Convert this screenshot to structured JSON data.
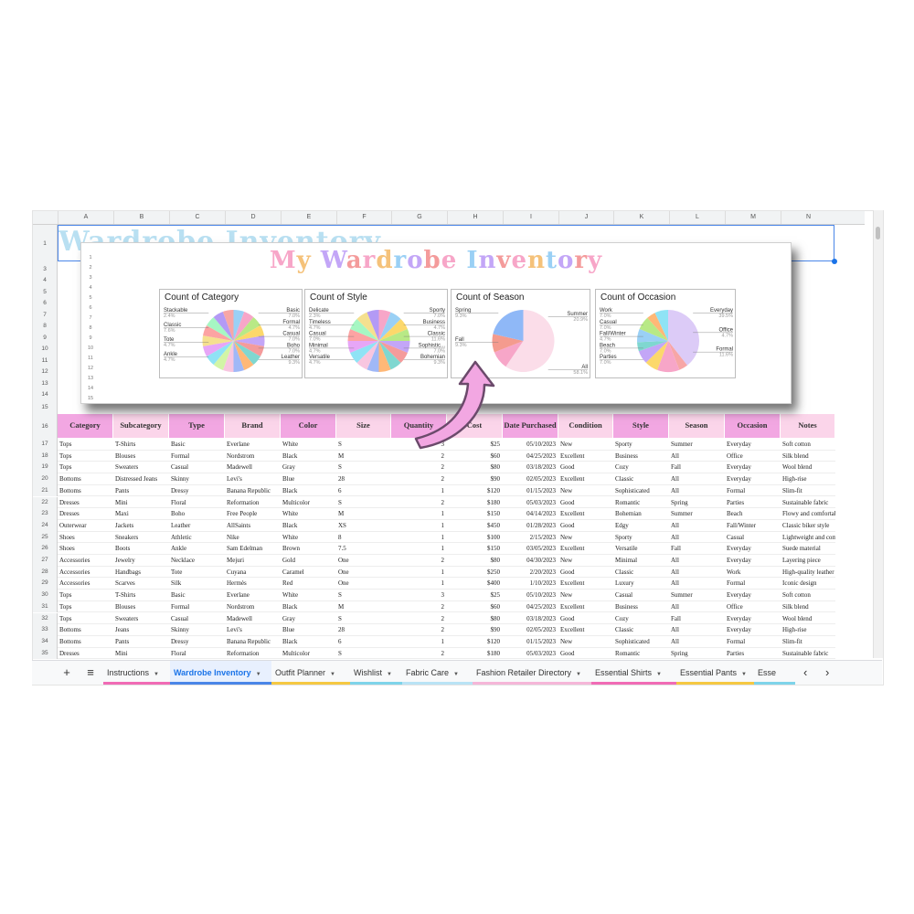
{
  "columns": [
    "A",
    "B",
    "C",
    "D",
    "E",
    "F",
    "G",
    "H",
    "I",
    "J",
    "K",
    "L",
    "M",
    "N"
  ],
  "row_numbers": [
    "1",
    "3",
    "4",
    "5",
    "6",
    "7",
    "8",
    "9",
    "10",
    "11",
    "12",
    "13",
    "14",
    "15",
    "16",
    "17",
    "18",
    "19",
    "20",
    "21",
    "22",
    "23",
    "24",
    "25",
    "26",
    "27",
    "28",
    "29",
    "30",
    "31",
    "32",
    "33",
    "34",
    "35"
  ],
  "sheet_title": "Wardrobe Inventory",
  "overlay": {
    "title": "My Wardrobe Inventory",
    "row_numbers": [
      "1",
      "2",
      "3",
      "4",
      "5",
      "6",
      "7",
      "8",
      "9",
      "10",
      "11",
      "12",
      "13",
      "14",
      "15"
    ]
  },
  "charts": [
    {
      "title": "Count of Category",
      "labels": [
        {
          "t": "Stackable",
          "p": "2.4%"
        },
        {
          "t": "Classic",
          "p": "7.6%"
        },
        {
          "t": "Tote",
          "p": "4.7%"
        },
        {
          "t": "Ankle",
          "p": "4.7%"
        },
        {
          "t": "Basic",
          "p": "7.0%"
        },
        {
          "t": "Formal",
          "p": "4.7%"
        },
        {
          "t": "Casual",
          "p": "7.0%"
        },
        {
          "t": "Boho",
          "p": "7.0%"
        },
        {
          "t": "Leather",
          "p": "9.3%"
        }
      ],
      "colors": [
        "#9ad0f5",
        "#f7a6c8",
        "#b8e986",
        "#fcd86b",
        "#c3a6f7",
        "#f49b9b",
        "#7fd7d0",
        "#ffb877",
        "#a0b8f7",
        "#f7c6e0",
        "#d2f5a6",
        "#8fe3f5",
        "#e7a6f7",
        "#f5e08f",
        "#fca3a3",
        "#a6f7c3",
        "#b39af5",
        "#f7a6a6"
      ]
    },
    {
      "title": "Count of Style",
      "labels": [
        {
          "t": "Delicate",
          "p": "2.3%"
        },
        {
          "t": "Timeless",
          "p": "4.7%"
        },
        {
          "t": "Casual",
          "p": "7.0%"
        },
        {
          "t": "Minimal",
          "p": "4.7%"
        },
        {
          "t": "Versatile",
          "p": "4.7%"
        },
        {
          "t": "Sporty",
          "p": "7.0%"
        },
        {
          "t": "Business",
          "p": "4.7%"
        },
        {
          "t": "Classic",
          "p": "11.6%"
        },
        {
          "t": "Sophistic...",
          "p": "7.0%"
        },
        {
          "t": "Bohemian",
          "p": "9.3%"
        }
      ],
      "colors": [
        "#f7a6c8",
        "#9ad0f5",
        "#fcd86b",
        "#b8e986",
        "#c3a6f7",
        "#f49b9b",
        "#7fd7d0",
        "#ffb877",
        "#a0b8f7",
        "#f7c6e0",
        "#8fe3f5",
        "#e7a6f7",
        "#fca3a3",
        "#a6f7c3",
        "#f5e08f",
        "#b39af5"
      ]
    },
    {
      "title": "Count of Season",
      "labels": [
        {
          "t": "Spring",
          "p": "9.3%"
        },
        {
          "t": "Fall",
          "p": "9.3%"
        },
        {
          "t": "Summer",
          "p": "20.9%"
        },
        {
          "t": "All",
          "p": "58.1%"
        }
      ],
      "values": [
        58.1,
        9.3,
        9.3,
        20.9
      ],
      "colors": [
        "#fbdde9",
        "#f7a6c8",
        "#f49b8e",
        "#8fb8f7"
      ]
    },
    {
      "title": "Count of Occasion",
      "labels": [
        {
          "t": "Work",
          "p": "7.0%"
        },
        {
          "t": "Casual",
          "p": "7.0%"
        },
        {
          "t": "Fall/Winter",
          "p": "4.7%"
        },
        {
          "t": "Beach",
          "p": "7.0%"
        },
        {
          "t": "Parties",
          "p": "7.0%"
        },
        {
          "t": "Everyday",
          "p": "39.5%"
        },
        {
          "t": "Office",
          "p": "4.7%"
        },
        {
          "t": "Formal",
          "p": "11.6%"
        }
      ],
      "values": [
        39.5,
        4.7,
        11.6,
        7.0,
        7.0,
        4.7,
        7.0,
        7.0,
        4.7,
        7.0
      ],
      "colors": [
        "#dccbf7",
        "#f7a6a6",
        "#f7a6c8",
        "#fcd86b",
        "#c3a6f7",
        "#7fd7d0",
        "#9ad0f5",
        "#b8e986",
        "#ffb877",
        "#8fe3f5"
      ]
    }
  ],
  "header": [
    "Category",
    "Subcategory",
    "Type",
    "Brand",
    "Color",
    "Size",
    "Quantity",
    "Cost",
    "Date Purchased",
    "Condition",
    "Style",
    "Season",
    "Occasion",
    "Notes"
  ],
  "header_colors": [
    "#f2a7e2",
    "#fbd5ea",
    "#f2a7e2",
    "#fbd5ea",
    "#f2a7e2",
    "#fbd5ea",
    "#f2a7e2",
    "#fbd5ea",
    "#f2a7e2",
    "#fbd5ea",
    "#f2a7e2",
    "#fbd5ea",
    "#f2a7e2",
    "#fbd5ea"
  ],
  "rows": [
    [
      "Tops",
      "T-Shirts",
      "Basic",
      "Everlane",
      "White",
      "S",
      "3",
      "$25",
      "05/10/2023",
      "New",
      "Sporty",
      "Summer",
      "Everyday",
      "Soft cotton"
    ],
    [
      "Tops",
      "Blouses",
      "Formal",
      "Nordstrom",
      "Black",
      "M",
      "2",
      "$60",
      "04/25/2023",
      "Excellent",
      "Business",
      "All",
      "Office",
      "Silk blend"
    ],
    [
      "Tops",
      "Sweaters",
      "Casual",
      "Madewell",
      "Gray",
      "S",
      "2",
      "$80",
      "03/18/2023",
      "Good",
      "Cozy",
      "Fall",
      "Everyday",
      "Wool blend"
    ],
    [
      "Bottoms",
      "Distressed Jeans",
      "Skinny",
      "Levi's",
      "Blue",
      "28",
      "2",
      "$90",
      "02/05/2023",
      "Excellent",
      "Classic",
      "All",
      "Everyday",
      "High-rise"
    ],
    [
      "Bottoms",
      "Pants",
      "Dressy",
      "Banana Republic",
      "Black",
      "6",
      "1",
      "$120",
      "01/15/2023",
      "New",
      "Sophisticated",
      "All",
      "Formal",
      "Slim-fit"
    ],
    [
      "Dresses",
      "Mini",
      "Floral",
      "Reformation",
      "Multicolor",
      "S",
      "2",
      "$180",
      "05/03/2023",
      "Good",
      "Romantic",
      "Spring",
      "Parties",
      "Sustainable fabric"
    ],
    [
      "Dresses",
      "Maxi",
      "Boho",
      "Free People",
      "White",
      "M",
      "1",
      "$150",
      "04/14/2023",
      "Excellent",
      "Bohemian",
      "Summer",
      "Beach",
      "Flowy and comfortable"
    ],
    [
      "Outerwear",
      "Jackets",
      "Leather",
      "AllSaints",
      "Black",
      "XS",
      "1",
      "$450",
      "01/28/2023",
      "Good",
      "Edgy",
      "All",
      "Fall/Winter",
      "Classic biker style"
    ],
    [
      "Shoes",
      "Sneakers",
      "Athletic",
      "Nike",
      "White",
      "8",
      "1",
      "$100",
      "2/15/2023",
      "New",
      "Sporty",
      "All",
      "Casual",
      "Lightweight and comfortable"
    ],
    [
      "Shoes",
      "Boots",
      "Ankle",
      "Sam Edelman",
      "Brown",
      "7.5",
      "1",
      "$150",
      "03/05/2023",
      "Excellent",
      "Versatile",
      "Fall",
      "Everyday",
      "Suede material"
    ],
    [
      "Accessories",
      "Jewelry",
      "Necklace",
      "Mejuri",
      "Gold",
      "One",
      "2",
      "$80",
      "04/30/2023",
      "New",
      "Minimal",
      "All",
      "Everyday",
      "Layering piece"
    ],
    [
      "Accessories",
      "Handbags",
      "Tote",
      "Cuyana",
      "Caramel",
      "One",
      "1",
      "$250",
      "2/20/2023",
      "Good",
      "Classic",
      "All",
      "Work",
      "High-quality leather"
    ],
    [
      "Accessories",
      "Scarves",
      "Silk",
      "Hermès",
      "Red",
      "One",
      "1",
      "$400",
      "1/10/2023",
      "Excellent",
      "Luxury",
      "All",
      "Formal",
      "Iconic design"
    ],
    [
      "Tops",
      "T-Shirts",
      "Basic",
      "Everlane",
      "White",
      "S",
      "3",
      "$25",
      "05/10/2023",
      "New",
      "Casual",
      "Summer",
      "Everyday",
      "Soft cotton"
    ],
    [
      "Tops",
      "Blouses",
      "Formal",
      "Nordstrom",
      "Black",
      "M",
      "2",
      "$60",
      "04/25/2023",
      "Excellent",
      "Business",
      "All",
      "Office",
      "Silk blend"
    ],
    [
      "Tops",
      "Sweaters",
      "Casual",
      "Madewell",
      "Gray",
      "S",
      "2",
      "$80",
      "03/18/2023",
      "Good",
      "Cozy",
      "Fall",
      "Everyday",
      "Wool blend"
    ],
    [
      "Bottoms",
      "Jeans",
      "Skinny",
      "Levi's",
      "Blue",
      "28",
      "2",
      "$90",
      "02/05/2023",
      "Excellent",
      "Classic",
      "All",
      "Everyday",
      "High-rise"
    ],
    [
      "Bottoms",
      "Pants",
      "Dressy",
      "Banana Republic",
      "Black",
      "6",
      "1",
      "$120",
      "01/15/2023",
      "New",
      "Sophisticated",
      "All",
      "Formal",
      "Slim-fit"
    ],
    [
      "Dresses",
      "Mini",
      "Floral",
      "Reformation",
      "Multicolor",
      "S",
      "2",
      "$180",
      "05/03/2023",
      "Good",
      "Romantic",
      "Spring",
      "Parties",
      "Sustainable fabric"
    ]
  ],
  "tabs": [
    {
      "label": "+",
      "color": ""
    },
    {
      "label": "≡",
      "color": ""
    },
    {
      "label": "Instructions",
      "color": "#f06bb5"
    },
    {
      "label": "Wardrobe Inventory",
      "color": "#4a86e8",
      "active": true
    },
    {
      "label": "Outfit Planner",
      "color": "#f5c842"
    },
    {
      "label": "Wishlist",
      "color": "#7ed4ea"
    },
    {
      "label": "Fabric Care",
      "color": "#b9e3f5"
    },
    {
      "label": "Fashion Retailer Directory",
      "color": "#f5b6d8"
    },
    {
      "label": "Essential Shirts",
      "color": "#f06bb5"
    },
    {
      "label": "Essential Pants",
      "color": "#f5c842"
    },
    {
      "label": "Esse",
      "color": "#7ed4ea"
    }
  ],
  "nav": {
    "prev": "‹",
    "next": "›"
  },
  "title_gradient": [
    "#f7a6c8",
    "#f5c27a",
    "#9ad0f5",
    "#c3a6f7",
    "#f49b9b"
  ]
}
